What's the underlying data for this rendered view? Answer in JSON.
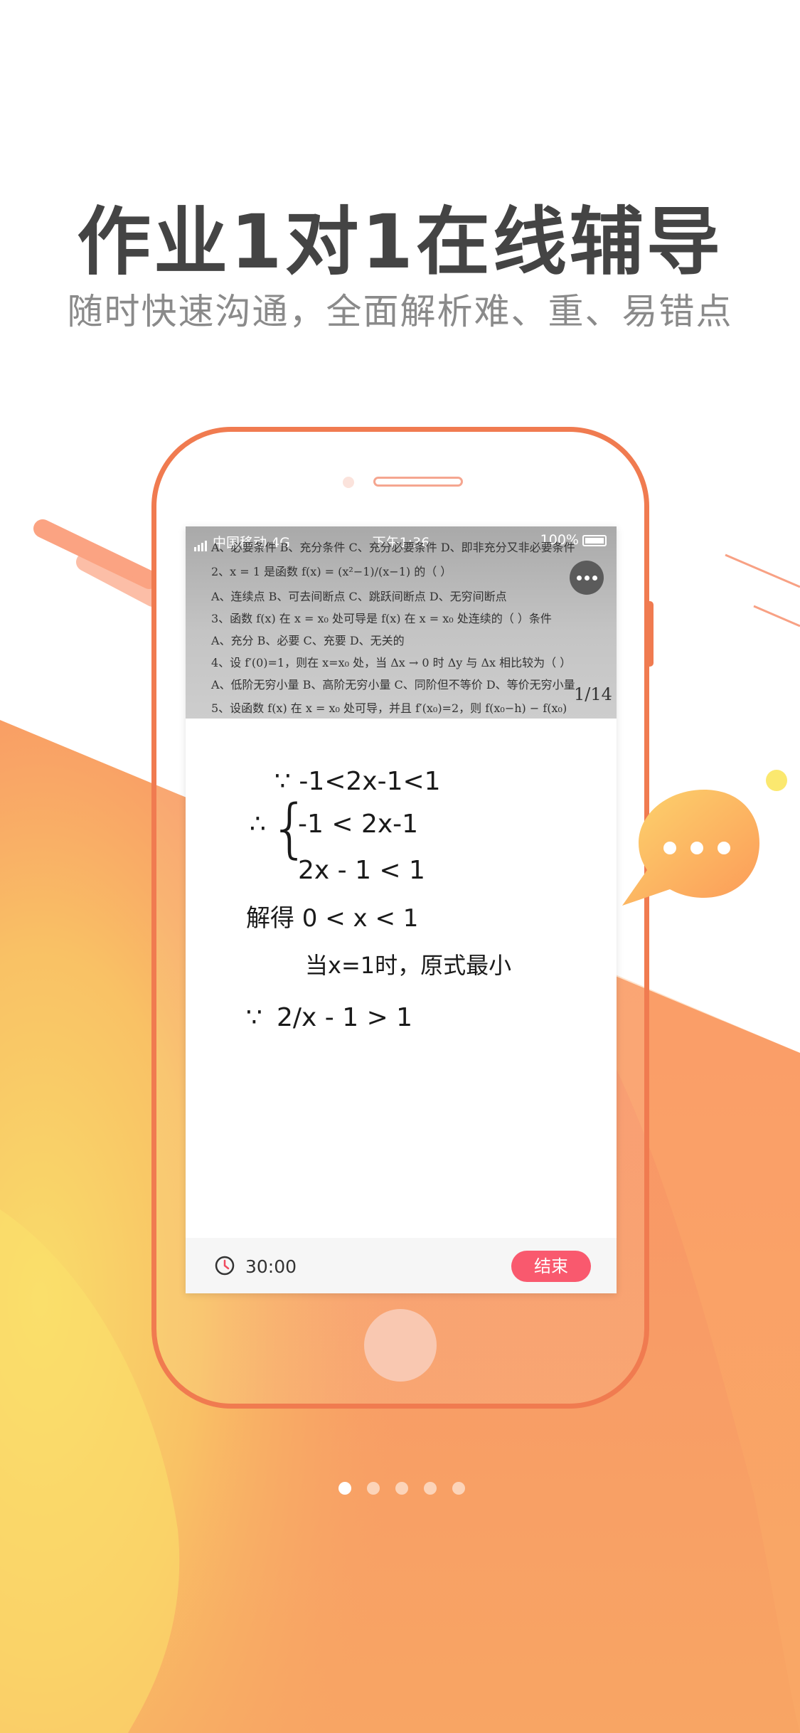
{
  "headline": "作业1对1在线辅导",
  "subtitle": "随时快速沟通，全面解析难、重、易错点",
  "status_bar": {
    "carrier": "中国移动 4G",
    "time": "下午1:36",
    "battery": "100%"
  },
  "question_sheet": {
    "lines": [
      "A、必要条件      B、充分条件      C、充分必要条件      D、即非充分又非必要条件",
      "2、x = 1 是函数 f(x) = (x²−1)/(x−1) 的（      ）",
      "A、连续点          B、可去间断点          C、跳跃间断点          D、无穷间断点",
      "3、函数 f(x) 在 x = x₀ 处可导是 f(x) 在 x = x₀ 处连续的（      ）条件",
      "A、充分                  B、必要                    C、充要                    D、无关的",
      "4、设 f′(0)=1，则在 x=x₀ 处，当 Δx → 0 时 Δy 与 Δx 相比较为（      ）",
      "A、低阶无穷小量     B、高阶无穷小量     C、同阶但不等价     D、等价无穷小量",
      "5、设函数 f(x) 在 x = x₀ 处可导，并且 f′(x₀)=2，则 f(x₀−h) − f(x₀)"
    ],
    "page_number": "1/14"
  },
  "handwriting": [
    "∵  -1<2x-1<1",
    "-1 < 2x-1",
    "2x - 1  < 1",
    "解得  0 < x < 1",
    "当x=1时，原式最小",
    "2/x - 1 > 1"
  ],
  "bottom_bar": {
    "timer": "30:00",
    "end_button": "结束"
  },
  "pagination": {
    "total": 5,
    "active_index": 0
  },
  "colors": {
    "brand_orange": "#f07b50",
    "end_button": "#f9596e",
    "headline": "#444444",
    "subtitle": "#8a8a8a"
  }
}
